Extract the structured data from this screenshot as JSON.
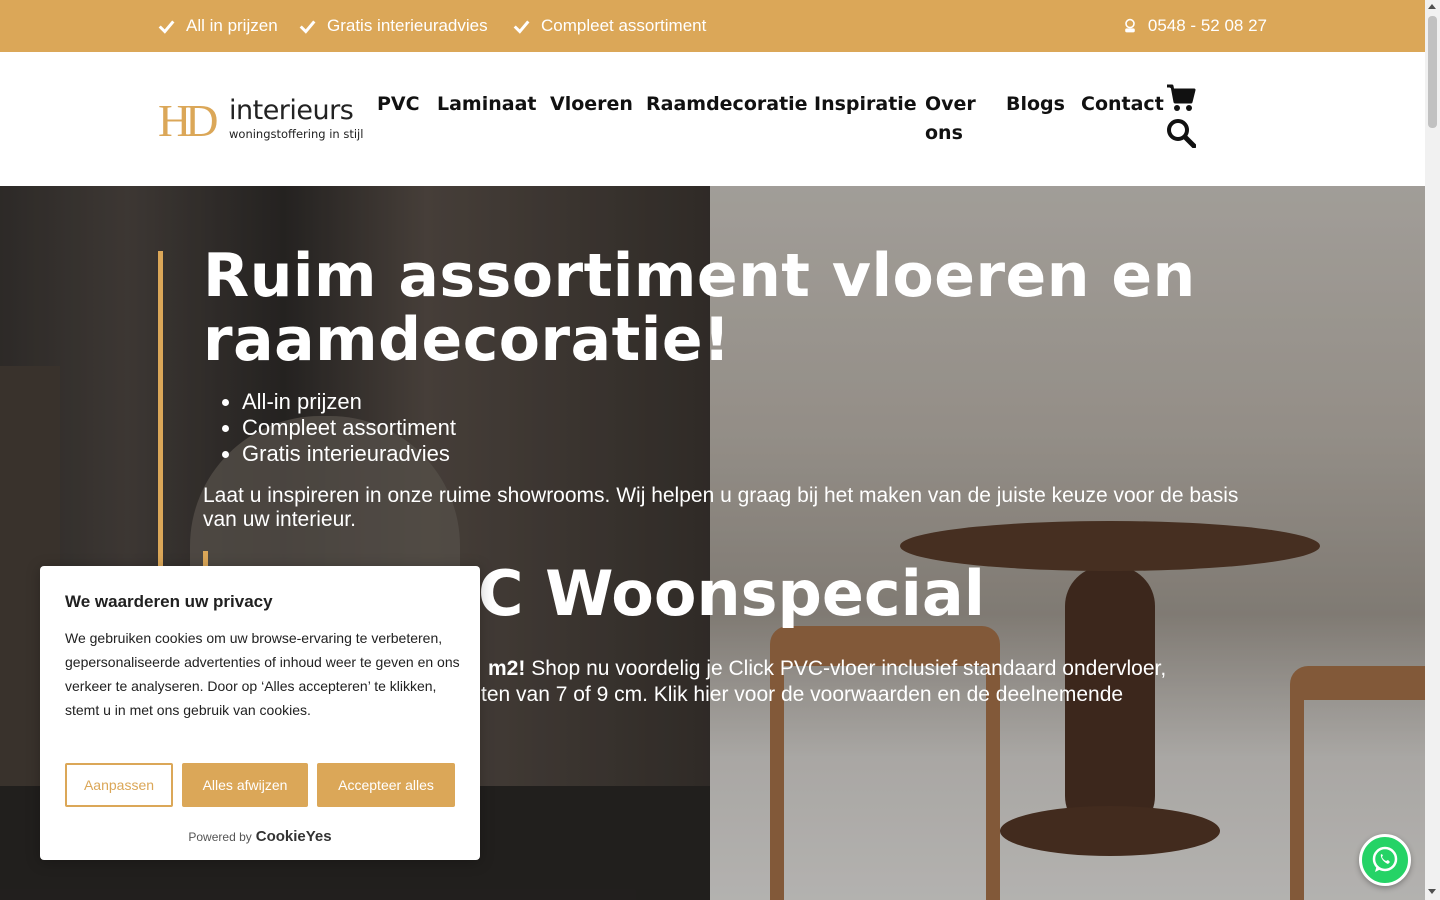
{
  "topbar": {
    "usps": [
      "All in prijzen",
      "Gratis interieuradvies",
      "Compleet assortiment"
    ],
    "phone": "0548 - 52 08 27",
    "background": "#dba758"
  },
  "header": {
    "logo": {
      "mark": "HD",
      "name": "interieurs",
      "tagline": "woningstoffering in stijl"
    },
    "nav": [
      "PVC",
      "Laminaat",
      "Vloeren",
      "Raamdecoratie",
      "Inspiratie",
      "Over ons",
      "Blogs",
      "Contact"
    ],
    "icons": [
      "cart-icon",
      "search-icon"
    ]
  },
  "hero": {
    "title": "Ruim assortiment vloeren en raamdecoratie!",
    "bullets": [
      "All-in prijzen",
      "Compleet assortiment",
      "Gratis interieuradvies"
    ],
    "intro": "Laat u inspireren in onze ruime showrooms. Wij helpen u graag bij het maken van de juiste keuze voor de basis van uw interieur.",
    "subtitle": "C Woonspecial",
    "promo_bold": "m2!",
    "promo_line1": " Shop nu voordelig je Click PVC-vloer inclusief standaard ondervloer,",
    "promo_line2": "ten van 7 of 9 cm. Klik hier voor de voorwaarden en de deelnemende"
  },
  "cookie": {
    "title": "We waarderen uw privacy",
    "text": "We gebruiken cookies om uw browse-ervaring te verbeteren, gepersonaliseerde advertenties of inhoud weer te geven en ons verkeer te analyseren. Door op ‘Alles accepteren’ te klikken, stemt u in met ons gebruik van cookies.",
    "buttons": {
      "customize": "Aanpassen",
      "reject": "Alles afwijzen",
      "accept": "Accepteer alles"
    },
    "powered_by": "Powered by",
    "brand": "CookieYes"
  },
  "colors": {
    "accent": "#dba758",
    "whatsapp": "#25d366"
  }
}
